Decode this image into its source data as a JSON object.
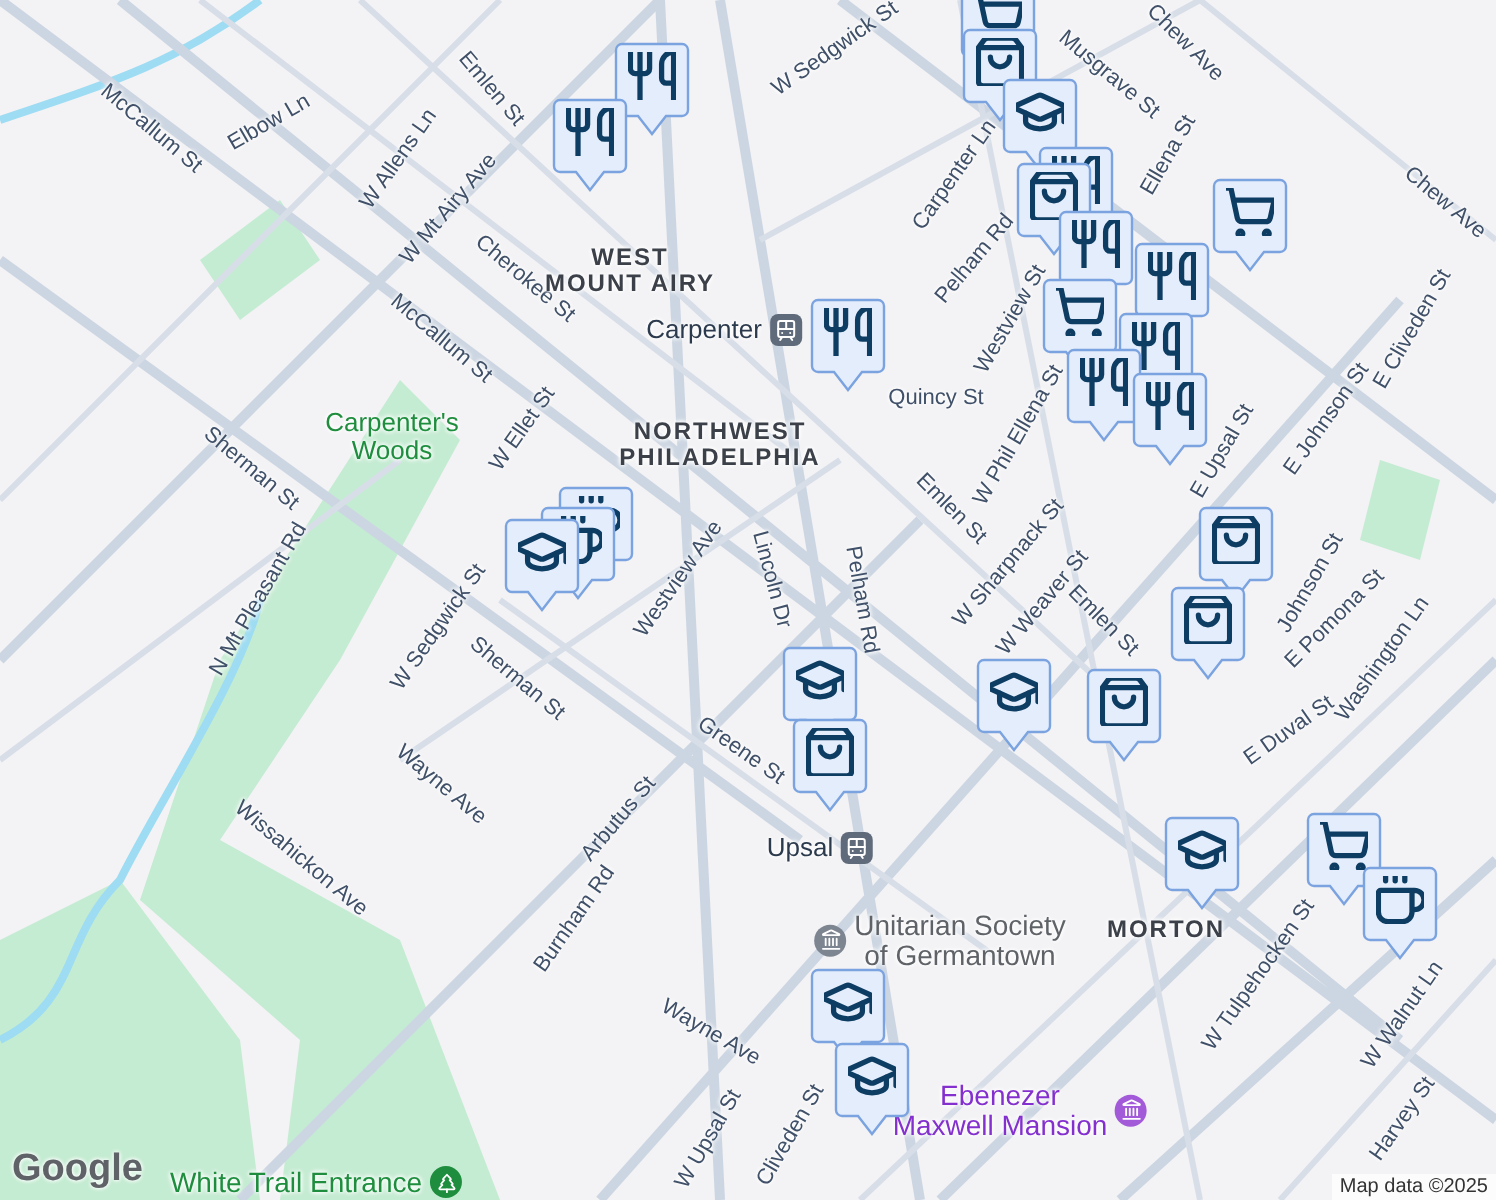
{
  "map": {
    "labels": [
      {
        "text": "McCallum St",
        "kind": "street"
      },
      {
        "text": "Elbow Ln",
        "kind": "street"
      },
      {
        "text": "W Allens Ln",
        "kind": "street"
      },
      {
        "text": "Emlen St",
        "kind": "street"
      },
      {
        "text": "W Mt Airy Ave",
        "kind": "street"
      },
      {
        "text": "Cherokee St",
        "kind": "street"
      },
      {
        "text": "McCallum St",
        "kind": "street"
      },
      {
        "text": "W Ellet St",
        "kind": "street"
      },
      {
        "text": "Sherman St",
        "kind": "street"
      },
      {
        "text": "N Mt Pleasant Rd",
        "kind": "street"
      },
      {
        "text": "W Sedgwick St",
        "kind": "street"
      },
      {
        "text": "Westview Ave",
        "kind": "street"
      },
      {
        "text": "Sherman St",
        "kind": "street"
      },
      {
        "text": "Lincoln Dr",
        "kind": "street"
      },
      {
        "text": "Pelham Rd",
        "kind": "street"
      },
      {
        "text": "Wayne Ave",
        "kind": "street"
      },
      {
        "text": "Arbutus St",
        "kind": "street"
      },
      {
        "text": "Greene St",
        "kind": "street"
      },
      {
        "text": "Burnham Rd",
        "kind": "street"
      },
      {
        "text": "Wayne Ave",
        "kind": "street"
      },
      {
        "text": "W Upsal St",
        "kind": "street"
      },
      {
        "text": "Cliveden St",
        "kind": "street"
      },
      {
        "text": "Wissahickon Ave",
        "kind": "street"
      },
      {
        "text": "Emlen St",
        "kind": "street"
      },
      {
        "text": "W Sharpnack St",
        "kind": "street"
      },
      {
        "text": "W Weaver St",
        "kind": "street"
      },
      {
        "text": "Emlen St",
        "kind": "street"
      },
      {
        "text": "E Duval St",
        "kind": "street"
      },
      {
        "text": "Washington Ln",
        "kind": "street"
      },
      {
        "text": "E Pomona St",
        "kind": "street"
      },
      {
        "text": "W Tulpehocken St",
        "kind": "street"
      },
      {
        "text": "W Walnut Ln",
        "kind": "street"
      },
      {
        "text": "Harvey St",
        "kind": "street"
      },
      {
        "text": "Quincy St",
        "kind": "street"
      },
      {
        "text": "Musgrave St",
        "kind": "street"
      },
      {
        "text": "Chew Ave",
        "kind": "street"
      },
      {
        "text": "W Sedgwick St",
        "kind": "street"
      },
      {
        "text": "Carpenter Ln",
        "kind": "street"
      },
      {
        "text": "Pelham Rd",
        "kind": "street"
      },
      {
        "text": "Westview St",
        "kind": "street"
      },
      {
        "text": "W Phil Ellena St",
        "kind": "street"
      },
      {
        "text": "E Johnson St",
        "kind": "street"
      },
      {
        "text": "E Upsal St",
        "kind": "street"
      },
      {
        "text": "Johnson St",
        "kind": "street"
      },
      {
        "text": "E Cliveden St",
        "kind": "street"
      },
      {
        "text": "Chew Ave",
        "kind": "street"
      },
      {
        "text": "Ellena St",
        "kind": "street"
      },
      {
        "text": "WEST\nMOUNT AIRY",
        "kind": "area"
      },
      {
        "text": "NORTHWEST\nPHILADELPHIA",
        "kind": "area"
      },
      {
        "text": "MORTON",
        "kind": "area"
      },
      {
        "text": "Carpenter's\nWoods",
        "kind": "park"
      },
      {
        "text": "Carpenter",
        "kind": "transit"
      },
      {
        "text": "Upsal",
        "kind": "transit"
      },
      {
        "text": "Unitarian Society\nof Germantown",
        "kind": "place"
      },
      {
        "text": "Ebenezer\nMaxwell Mansion",
        "kind": "historic"
      },
      {
        "text": "White Trail Entrance",
        "kind": "trail"
      }
    ],
    "markers": [
      {
        "kind": "restaurant"
      },
      {
        "kind": "restaurant"
      },
      {
        "kind": "grocery"
      },
      {
        "kind": "shopping"
      },
      {
        "kind": "school"
      },
      {
        "kind": "restaurant"
      },
      {
        "kind": "shopping"
      },
      {
        "kind": "restaurant"
      },
      {
        "kind": "restaurant"
      },
      {
        "kind": "grocery"
      },
      {
        "kind": "restaurant"
      },
      {
        "kind": "restaurant"
      },
      {
        "kind": "restaurant"
      },
      {
        "kind": "grocery"
      },
      {
        "kind": "restaurant"
      },
      {
        "kind": "cafe"
      },
      {
        "kind": "cafe"
      },
      {
        "kind": "school"
      },
      {
        "kind": "school"
      },
      {
        "kind": "shopping"
      },
      {
        "kind": "school"
      },
      {
        "kind": "shopping"
      },
      {
        "kind": "shopping"
      },
      {
        "kind": "shopping"
      },
      {
        "kind": "school"
      },
      {
        "kind": "grocery"
      },
      {
        "kind": "cafe"
      },
      {
        "kind": "school"
      },
      {
        "kind": "school"
      }
    ],
    "logo": "Google",
    "attribution": "Map data ©2025"
  }
}
